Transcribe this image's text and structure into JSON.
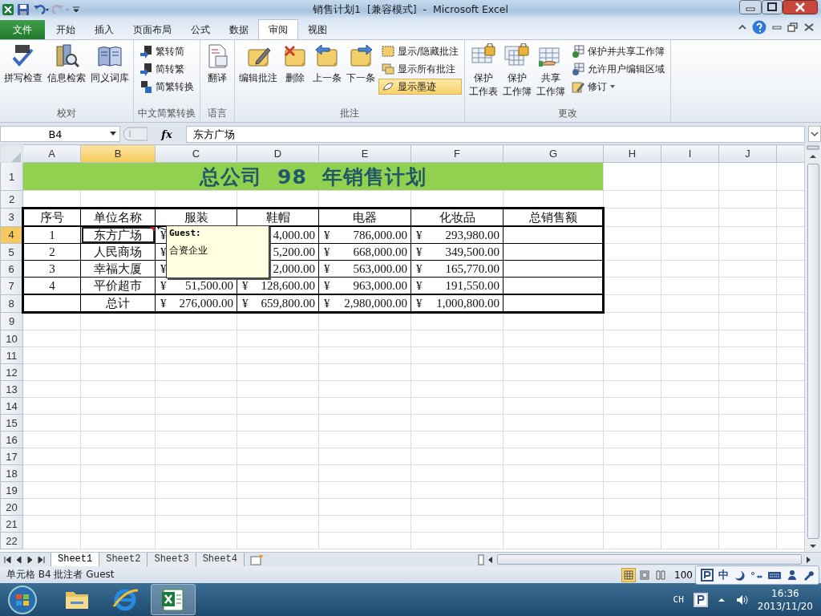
{
  "title_bar": {
    "title": "销售计划1  [兼容模式]  -  Microsoft Excel"
  },
  "ribbon": {
    "file_tab": "文件",
    "tabs": [
      {
        "label": "开始",
        "selected": false
      },
      {
        "label": "插入",
        "selected": false
      },
      {
        "label": "页面布局",
        "selected": false
      },
      {
        "label": "公式",
        "selected": false
      },
      {
        "label": "数据",
        "selected": false
      },
      {
        "label": "审阅",
        "selected": true
      },
      {
        "label": "视图",
        "selected": false
      }
    ],
    "groups": [
      {
        "label": "校对",
        "items": [
          {
            "kind": "large",
            "lines": [
              "拼写检查"
            ]
          },
          {
            "kind": "large",
            "lines": [
              "信息检索"
            ]
          },
          {
            "kind": "large",
            "lines": [
              "同义词库"
            ]
          }
        ]
      },
      {
        "label": "中文简繁转换",
        "items": [
          {
            "kind": "small",
            "label": "繁转简",
            "on": false
          },
          {
            "kind": "small",
            "label": "简转繁",
            "on": false
          },
          {
            "kind": "small",
            "label": "简繁转换",
            "on": false
          }
        ]
      },
      {
        "label": "语言",
        "items": [
          {
            "kind": "large",
            "lines": [
              "翻译"
            ]
          }
        ]
      },
      {
        "label": "批注",
        "items": [
          {
            "kind": "large",
            "lines": [
              "编辑批注"
            ]
          },
          {
            "kind": "large",
            "lines": [
              "删除"
            ]
          },
          {
            "kind": "large",
            "lines": [
              "上一条"
            ]
          },
          {
            "kind": "large",
            "lines": [
              "下一条"
            ]
          },
          {
            "kind": "small",
            "label": "显示/隐藏批注",
            "on": false
          },
          {
            "kind": "small",
            "label": "显示所有批注",
            "on": false
          },
          {
            "kind": "small",
            "label": "显示墨迹",
            "on": true
          }
        ]
      },
      {
        "label": "更改",
        "items": [
          {
            "kind": "large",
            "lines": [
              "保护",
              "工作表"
            ]
          },
          {
            "kind": "large",
            "lines": [
              "保护",
              "工作簿"
            ]
          },
          {
            "kind": "large",
            "lines": [
              "共享",
              "工作簿"
            ]
          },
          {
            "kind": "small",
            "label": "保护并共享工作簿",
            "on": false
          },
          {
            "kind": "small",
            "label": "允许用户编辑区域",
            "on": false
          },
          {
            "kind": "dropdown",
            "label": "修订",
            "on": false
          }
        ]
      }
    ]
  },
  "formula_bar": {
    "name_box": "B4",
    "function_label": "fx",
    "content": "东方广场"
  },
  "sheet": {
    "columns": [
      {
        "label": "A",
        "selected": false
      },
      {
        "label": "B",
        "selected": true
      },
      {
        "label": "C",
        "selected": false
      },
      {
        "label": "D",
        "selected": false
      },
      {
        "label": "E",
        "selected": false
      },
      {
        "label": "F",
        "selected": false
      },
      {
        "label": "G",
        "selected": false
      },
      {
        "label": "H",
        "selected": false
      },
      {
        "label": "I",
        "selected": false
      },
      {
        "label": "J",
        "selected": false
      }
    ],
    "rows": [
      {
        "number": "1",
        "selected": false,
        "kind": "title",
        "title": "总公司  98  年销售计划"
      },
      {
        "number": "2",
        "selected": false,
        "kind": "empty"
      },
      {
        "number": "3",
        "selected": false,
        "kind": "header",
        "cells": [
          {
            "text": "序号"
          },
          {
            "text": "单位名称"
          },
          {
            "text": "服装"
          },
          {
            "text": "鞋帽"
          },
          {
            "text": "电器"
          },
          {
            "text": "化妆品"
          },
          {
            "text": "总销售额"
          }
        ]
      },
      {
        "number": "4",
        "selected": true,
        "kind": "data",
        "cells": [
          {
            "text": "1"
          },
          {
            "text": "东方广场"
          },
          {
            "currency": "¥"
          },
          {
            "amount": "4,000.00"
          },
          {
            "currency": "¥",
            "amount": "786,000.00"
          },
          {
            "currency": "¥",
            "amount": "293,980.00"
          },
          null
        ]
      },
      {
        "number": "5",
        "selected": false,
        "kind": "data",
        "cells": [
          {
            "text": "2"
          },
          {
            "text": "人民商场"
          },
          {
            "currency": "¥"
          },
          {
            "amount": "5,200.00"
          },
          {
            "currency": "¥",
            "amount": "668,000.00"
          },
          {
            "currency": "¥",
            "amount": "349,500.00"
          },
          null
        ]
      },
      {
        "number": "6",
        "selected": false,
        "kind": "data",
        "cells": [
          {
            "text": "3"
          },
          {
            "text": "幸福大厦"
          },
          {
            "currency": "¥"
          },
          {
            "amount": "2,000.00"
          },
          {
            "currency": "¥",
            "amount": "563,000.00"
          },
          {
            "currency": "¥",
            "amount": "165,770.00"
          },
          null
        ]
      },
      {
        "number": "7",
        "selected": false,
        "kind": "data",
        "cells": [
          {
            "text": "4"
          },
          {
            "text": "平价超市"
          },
          {
            "currency": "¥",
            "amount": "51,500.00"
          },
          {
            "currency": "¥",
            "amount": "128,600.00"
          },
          {
            "currency": "¥",
            "amount": "963,000.00"
          },
          {
            "currency": "¥",
            "amount": "191,550.00"
          },
          null
        ]
      },
      {
        "number": "8",
        "selected": false,
        "kind": "total",
        "cells": [
          null,
          {
            "text": "总计"
          },
          {
            "currency": "¥",
            "amount": "276,000.00"
          },
          {
            "currency": "¥",
            "amount": "659,800.00"
          },
          {
            "currency": "¥",
            "amount": "2,980,000.00"
          },
          {
            "currency": "¥",
            "amount": "1,000,800.00"
          },
          null
        ]
      },
      {
        "number": "9",
        "selected": false,
        "kind": "empty"
      },
      {
        "number": "10",
        "selected": false,
        "kind": "empty"
      },
      {
        "number": "11",
        "selected": false,
        "kind": "empty"
      },
      {
        "number": "12",
        "selected": false,
        "kind": "empty"
      },
      {
        "number": "13",
        "selected": false,
        "kind": "empty"
      },
      {
        "number": "14",
        "selected": false,
        "kind": "empty"
      },
      {
        "number": "15",
        "selected": false,
        "kind": "empty"
      },
      {
        "number": "16",
        "selected": false,
        "kind": "empty"
      },
      {
        "number": "17",
        "selected": false,
        "kind": "empty"
      },
      {
        "number": "18",
        "selected": false,
        "kind": "empty"
      },
      {
        "number": "19",
        "selected": false,
        "kind": "empty"
      },
      {
        "number": "20",
        "selected": false,
        "kind": "empty"
      },
      {
        "number": "21",
        "selected": false,
        "kind": "empty"
      },
      {
        "number": "22",
        "selected": false,
        "kind": "empty"
      }
    ],
    "comment": {
      "author": "Guest:",
      "text": "合资企业"
    }
  },
  "sheet_tabs": [
    {
      "label": "Sheet1",
      "selected": true
    },
    {
      "label": "Sheet2",
      "selected": false
    },
    {
      "label": "Sheet3",
      "selected": false
    },
    {
      "label": "Sheet4",
      "selected": false
    }
  ],
  "status_bar": {
    "text": "单元格 B4 批注者 Guest",
    "zoom": "100",
    "views": [
      {
        "selected": true
      },
      {
        "selected": false
      },
      {
        "selected": false
      }
    ]
  },
  "ime_bar": {
    "mode": "中"
  },
  "taskbar": {
    "apps": [
      {
        "selected": false
      },
      {
        "selected": false
      },
      {
        "selected": true
      }
    ],
    "language": "CH",
    "time": "16:36",
    "date": "2013/11/20"
  }
}
